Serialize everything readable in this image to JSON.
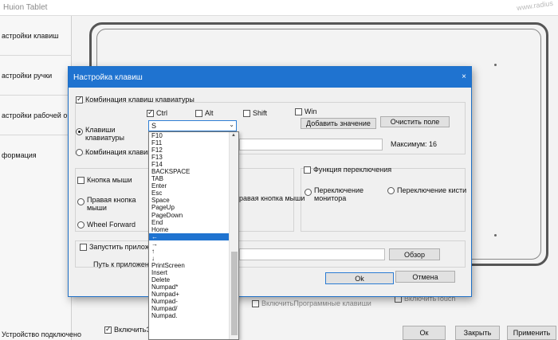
{
  "main": {
    "title": "Huion Tablet",
    "watermark": "www.radius",
    "sidebar": [
      "астройки клавиш",
      "астройки ручки",
      "астройки рабочей обла",
      "формация"
    ],
    "device_status": "Устройство подключено",
    "bottom_options": {
      "enable_express": {
        "label": "ВключитьЭкс",
        "checked": true
      },
      "enable_program_keys": {
        "label": "ВключитьПрограммные клавиши",
        "checked": false
      },
      "enable_touch": {
        "label": "ВключитьTouch",
        "checked": false
      }
    },
    "buttons": {
      "ok": "Ок",
      "close": "Закрыть",
      "apply": "Применить"
    }
  },
  "dialog": {
    "title": "Настройка клавиш",
    "close_glyph": "×",
    "key_combination": {
      "label": "Комбинация клавиш клавиатуры",
      "checked": true
    },
    "radio_keyboard_keys": {
      "line1": "Клавиши",
      "line2": "клавиатуры",
      "checked": true
    },
    "radio_combination": "Комбинация клавиш",
    "modifiers": {
      "ctrl": {
        "label": "Ctrl",
        "checked": true
      },
      "alt": {
        "label": "Alt",
        "checked": false
      },
      "shift": {
        "label": "Shift",
        "checked": false
      },
      "win": {
        "label": "Win",
        "checked": false
      }
    },
    "add_value_button": "Добавить значение",
    "clear_field_button": "Очистить поле",
    "maximum_label": "Максимум: 16",
    "mouse_button": {
      "label": "Кнопка мыши",
      "checked": false
    },
    "right_mouse": {
      "line1": "Правая кнопка",
      "line2": "мыши"
    },
    "right_mouse_truncated": "равая кнопка мыши",
    "wheel_forward": "Wheel Forward",
    "switch_function": {
      "label": "Функция переключения",
      "checked": false
    },
    "switch_monitor": {
      "line1": "Переключение",
      "line2": "монитора"
    },
    "switch_brush": "Переключение кисти",
    "launch_app": {
      "label": "Запустить приложе",
      "checked": false
    },
    "app_path_label": "Путь к приложени",
    "browse_button": "Обзор",
    "ok_button": "Ok",
    "cancel_button": "Отмена"
  },
  "dropdown": {
    "selected_value": "S",
    "arrow": "⌄",
    "items": [
      "F10",
      "F11",
      "F12",
      "F13",
      "F14",
      "BACKSPACE",
      "TAB",
      "Enter",
      "Esc",
      "Space",
      "PageUp",
      "PageDown",
      "End",
      "Home",
      "←",
      "→",
      "↑",
      "↓",
      "PrintScreen",
      "Insert",
      "Delete",
      "Numpad*",
      "Numpad+",
      "Numpad-",
      "Numpad/",
      "Numpad."
    ],
    "highlighted_index": 14
  }
}
